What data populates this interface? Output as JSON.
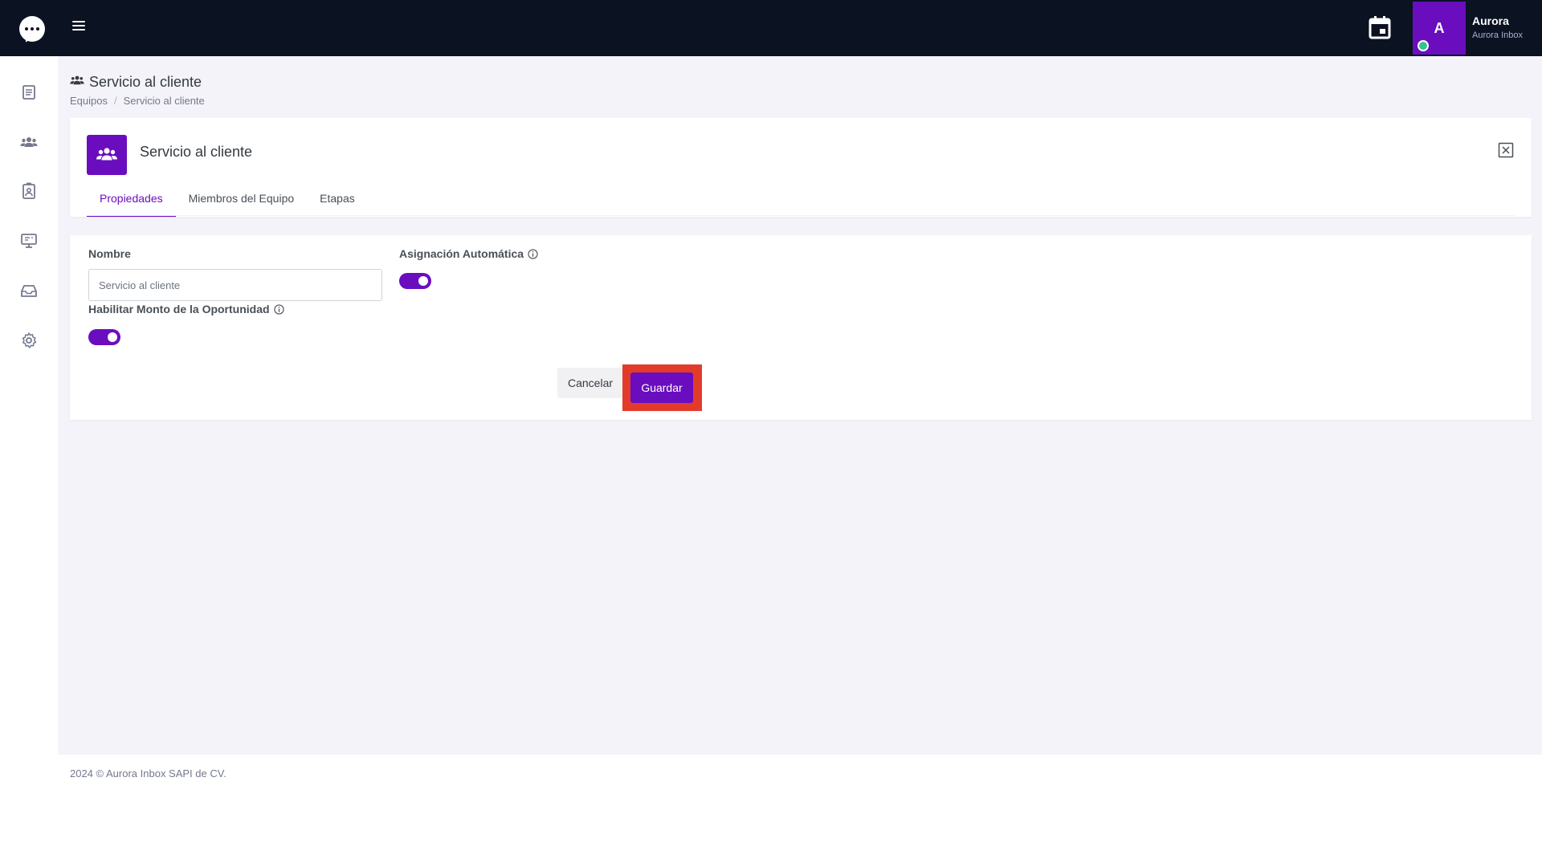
{
  "topbar": {
    "user_initial": "A",
    "user_name": "Aurora",
    "user_org": "Aurora Inbox"
  },
  "sidebar": {
    "icons": [
      "list-icon",
      "users-icon",
      "contact-icon",
      "monitor-icon",
      "inbox-icon",
      "gear-icon"
    ]
  },
  "page": {
    "title": "Servicio al cliente",
    "breadcrumb": [
      "Equipos",
      "Servicio al cliente"
    ]
  },
  "team_card": {
    "title": "Servicio al cliente",
    "tabs": [
      {
        "label": "Propiedades",
        "active": true
      },
      {
        "label": "Miembros del Equipo",
        "active": false
      },
      {
        "label": "Etapas",
        "active": false
      }
    ]
  },
  "form": {
    "name_label": "Nombre",
    "name_placeholder": "Servicio al cliente",
    "auto_assign_label": "Asignación Automática",
    "auto_assign_enabled": true,
    "opportunity_label": "Habilitar Monto de la Oportunidad",
    "opportunity_enabled": true,
    "cancel_label": "Cancelar",
    "save_label": "Guardar"
  },
  "footer": {
    "text": "2024 © Aurora Inbox SAPI de CV."
  },
  "colors": {
    "brand": "#6a0dbf",
    "topbar": "#0b1222",
    "highlight": "#e23b2a",
    "status_online": "#34c38f"
  }
}
